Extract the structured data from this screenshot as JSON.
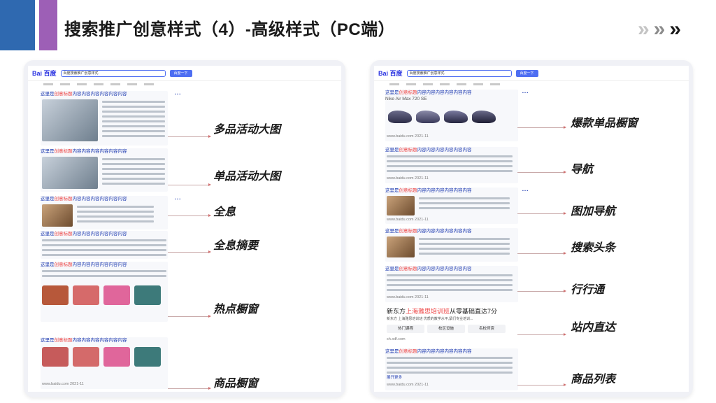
{
  "slide": {
    "title": "搜索推广创意样式（4）-高级样式（PC端）",
    "accent_colors": [
      "#2f69b0",
      "#9d5fb6"
    ],
    "chevron_colors": [
      "#c4c4c4",
      "#8c8c8c",
      "#1a1a1a"
    ]
  },
  "left_labels": [
    "多品活动大图",
    "单品活动大图",
    "全息",
    "全息摘要",
    "热点橱窗",
    "商品橱窗"
  ],
  "right_labels": [
    "爆款单品橱窗",
    "导航",
    "图加导航",
    "搜索头条",
    "行行通",
    "站内直达",
    "商品列表"
  ],
  "search": {
    "logo": "Bai 百度",
    "query": "百度搜索推广创意样式",
    "button": "百度一下"
  },
  "result": {
    "title_prefix": "这里是",
    "title_highlight": "创意标题",
    "title_suffix": "内容内容内容内容内容内容",
    "url": "www.baidu.com 2021-11"
  },
  "right_panel": {
    "product_name": "Nike Air Max 720 SE",
    "headline_prefix": "新东方",
    "headline_highlight": "上海雅思培训班",
    "headline_suffix": "从零基础直达7分",
    "headline_subtext": "新东方 上海雅思培训班 优质的教学水平,紧们专业培训...",
    "chips": [
      "热门课程",
      "校区设施",
      "名校师资"
    ],
    "headline_url": "sh.xdf.com",
    "expand": "展开更多"
  }
}
